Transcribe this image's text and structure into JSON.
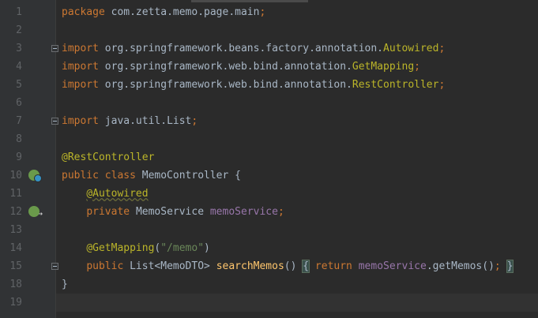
{
  "editor": {
    "lines": [
      {
        "n": "1",
        "tokens": [
          {
            "t": "package ",
            "c": "kw"
          },
          {
            "t": "com.zetta.memo.page.main",
            "c": "plain"
          },
          {
            "t": ";",
            "c": "kw"
          }
        ]
      },
      {
        "n": "2",
        "tokens": []
      },
      {
        "n": "3",
        "tokens": [
          {
            "t": "import ",
            "c": "kw"
          },
          {
            "t": "org.springframework.beans.factory.annotation.",
            "c": "plain"
          },
          {
            "t": "Autowired",
            "c": "ann"
          },
          {
            "t": ";",
            "c": "kw"
          }
        ]
      },
      {
        "n": "4",
        "tokens": [
          {
            "t": "import ",
            "c": "kw"
          },
          {
            "t": "org.springframework.web.bind.annotation.",
            "c": "plain"
          },
          {
            "t": "GetMapping",
            "c": "ann"
          },
          {
            "t": ";",
            "c": "kw"
          }
        ]
      },
      {
        "n": "5",
        "tokens": [
          {
            "t": "import ",
            "c": "kw"
          },
          {
            "t": "org.springframework.web.bind.annotation.",
            "c": "plain"
          },
          {
            "t": "RestController",
            "c": "ann"
          },
          {
            "t": ";",
            "c": "kw"
          }
        ]
      },
      {
        "n": "6",
        "tokens": []
      },
      {
        "n": "7",
        "tokens": [
          {
            "t": "import ",
            "c": "kw"
          },
          {
            "t": "java.util.List",
            "c": "plain"
          },
          {
            "t": ";",
            "c": "kw"
          }
        ]
      },
      {
        "n": "8",
        "tokens": []
      },
      {
        "n": "9",
        "tokens": [
          {
            "t": "@RestController",
            "c": "ann"
          }
        ]
      },
      {
        "n": "10",
        "tokens": [
          {
            "t": "public class ",
            "c": "kw"
          },
          {
            "t": "MemoController {",
            "c": "plain"
          }
        ]
      },
      {
        "n": "11",
        "tokens": [
          {
            "t": "    ",
            "c": "plain"
          },
          {
            "t": "@Autowired",
            "c": "ann wavy"
          }
        ]
      },
      {
        "n": "12",
        "tokens": [
          {
            "t": "    ",
            "c": "plain"
          },
          {
            "t": "private ",
            "c": "kw"
          },
          {
            "t": "MemoService ",
            "c": "plain"
          },
          {
            "t": "memoService",
            "c": "fld"
          },
          {
            "t": ";",
            "c": "kw"
          }
        ]
      },
      {
        "n": "13",
        "tokens": []
      },
      {
        "n": "14",
        "tokens": [
          {
            "t": "    ",
            "c": "plain"
          },
          {
            "t": "@GetMapping",
            "c": "ann"
          },
          {
            "t": "(",
            "c": "plain"
          },
          {
            "t": "\"/memo\"",
            "c": "str"
          },
          {
            "t": ")",
            "c": "plain"
          }
        ]
      },
      {
        "n": "15",
        "tokens": [
          {
            "t": "    ",
            "c": "plain"
          },
          {
            "t": "public ",
            "c": "kw"
          },
          {
            "t": "List<MemoDTO> ",
            "c": "plain"
          },
          {
            "t": "searchMemos",
            "c": "fn"
          },
          {
            "t": "() ",
            "c": "plain"
          },
          {
            "t": "{",
            "c": "plain brace-hl"
          },
          {
            "t": " return ",
            "c": "kw"
          },
          {
            "t": "memoService",
            "c": "fld"
          },
          {
            "t": ".getMemos()",
            "c": "plain"
          },
          {
            "t": ";",
            "c": "kw"
          },
          {
            "t": " ",
            "c": "plain"
          },
          {
            "t": "}",
            "c": "plain brace-hl"
          }
        ]
      },
      {
        "n": "18",
        "tokens": [
          {
            "t": "}",
            "c": "plain"
          }
        ]
      },
      {
        "n": "19",
        "tokens": []
      }
    ],
    "current_line": "19",
    "gutter_icons": [
      {
        "line": "10",
        "name": "spring-bean-class-icon"
      },
      {
        "line": "12",
        "name": "spring-bean-autowired-icon"
      }
    ],
    "fold_markers": [
      "3",
      "7",
      "15"
    ]
  }
}
